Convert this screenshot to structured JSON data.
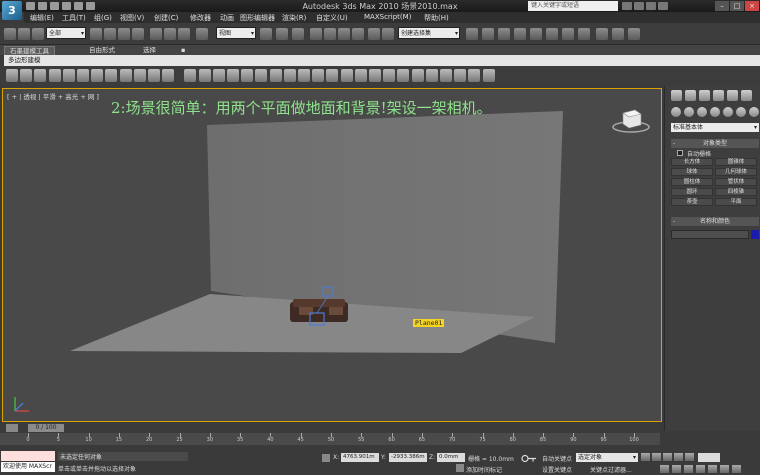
{
  "window": {
    "title": "Autodesk 3ds Max 2010    场景2010.max",
    "search_placeholder": "键入关键字或短语"
  },
  "menu": [
    "编辑(E)",
    "工具(T)",
    "组(G)",
    "视图(V)",
    "创建(C)",
    "修改器",
    "动画",
    "图形编辑器",
    "渲染(R)",
    "自定义(U)",
    "MAXScript(M)",
    "帮助(H)"
  ],
  "toolbar": {
    "selection_filter": "全部",
    "ref_coord": "视图",
    "named_selection": "创建选择集"
  },
  "ribbon": {
    "tabs": [
      "石墨建模工具",
      "自由形式",
      "选择"
    ],
    "subpanel": "多边形建模"
  },
  "viewport": {
    "label": "[ + | 透视 | 平滑 + 高光 + 网 ]",
    "annotation": "2:场景很简单：用两个平面做地面和背景!架设一架相机。",
    "object_label": "Plane01"
  },
  "command_panel": {
    "category_dropdown": "标准基本体",
    "object_type_header": "对象类型",
    "autogrid_label": "自动栅格",
    "object_buttons": [
      "长方体",
      "圆锥体",
      "球体",
      "几何球体",
      "圆柱体",
      "管状体",
      "圆环",
      "四棱锥",
      "茶壶",
      "平面"
    ],
    "name_color_header": "名称和颜色",
    "swatch_color": "#1b1bb0"
  },
  "timeline": {
    "frame_display": "0 / 100",
    "ticks": [
      0,
      5,
      10,
      15,
      20,
      25,
      30,
      35,
      40,
      45,
      50,
      55,
      60,
      65,
      70,
      75,
      80,
      85,
      90,
      95,
      100
    ]
  },
  "status": {
    "maxscript_label": "欢迎使用 MAXScr",
    "status_line1": "未选定任何对象",
    "status_line2": "单击或单击并拖动以选择对象",
    "x_value": "4763.901m",
    "y_value": "-2933.386m",
    "z_value": "0.0mm",
    "grid_text": "栅格 = 10.0mm",
    "add_time_tag": "添加时间标记",
    "auto_key": "自动关键点",
    "set_key": "设置关键点",
    "selected_objects": "选定对象",
    "key_filters": "关键点过滤器..."
  },
  "colors": {
    "viewport_border": "#d9a400",
    "annotation": "#8ee38c",
    "object_label_bg": "#f5d423"
  }
}
